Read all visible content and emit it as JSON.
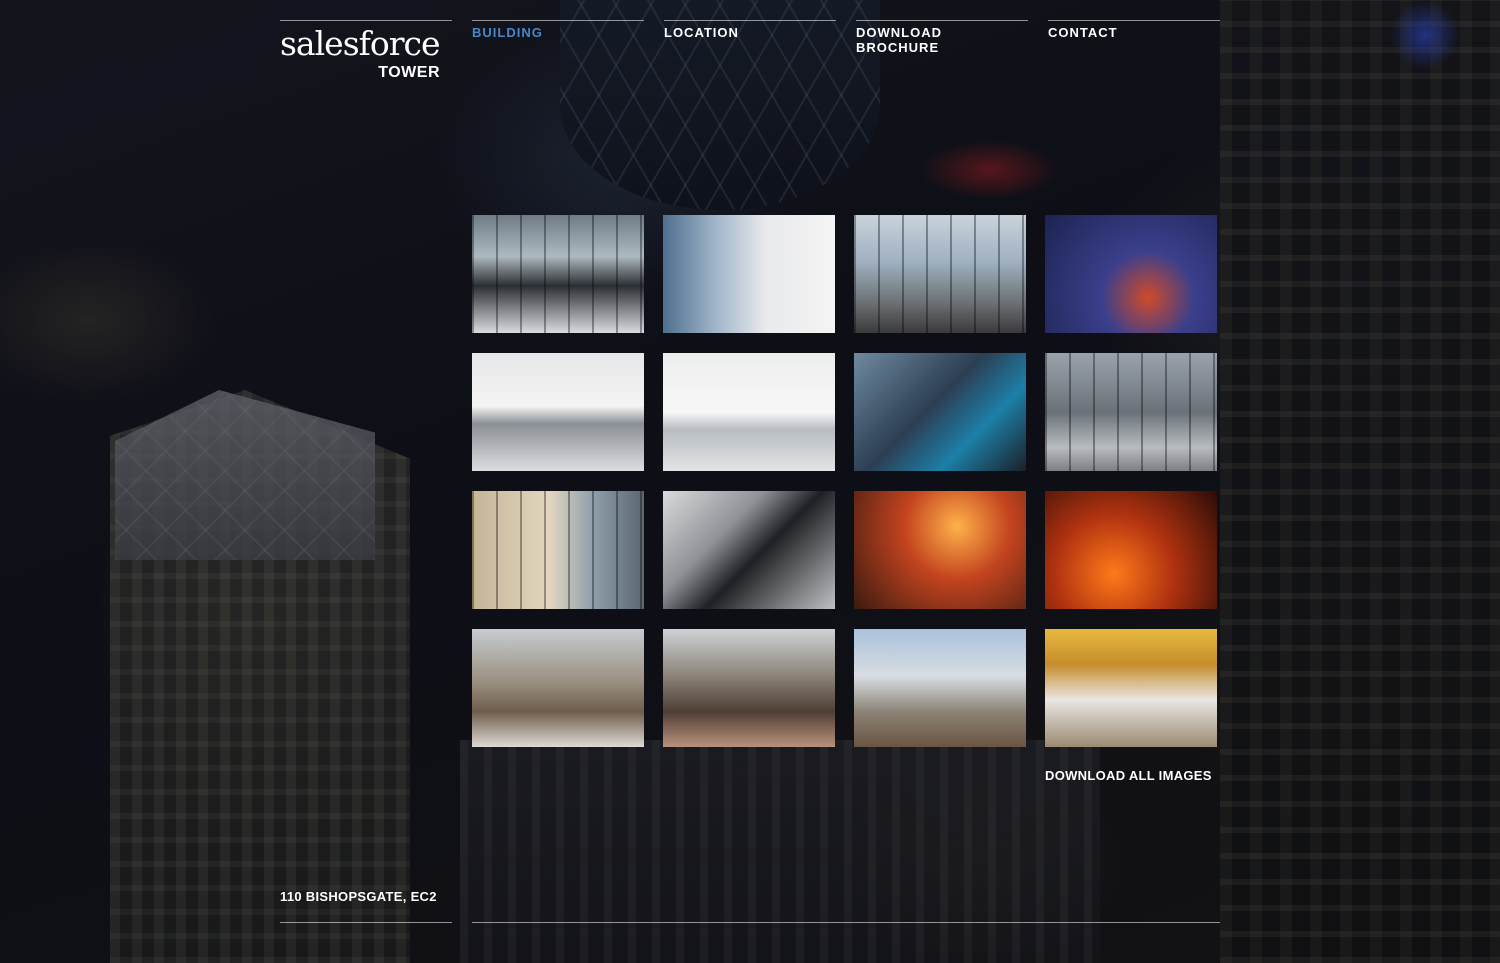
{
  "header": {
    "logo_line1": "salesforce",
    "logo_line2": "TOWER",
    "nav": [
      {
        "label": "BUILDING",
        "active": true
      },
      {
        "label": "LOCATION",
        "active": false
      },
      {
        "label": "DOWNLOAD BROCHURE",
        "active": false
      },
      {
        "label": "CONTACT",
        "active": false
      }
    ]
  },
  "gallery": {
    "download_all_label": "DOWNLOAD ALL IMAGES"
  },
  "footer": {
    "address": "110 BISHOPSGATE, EC2"
  },
  "colors": {
    "active_nav": "#4a86c8",
    "text": "#ffffff"
  }
}
